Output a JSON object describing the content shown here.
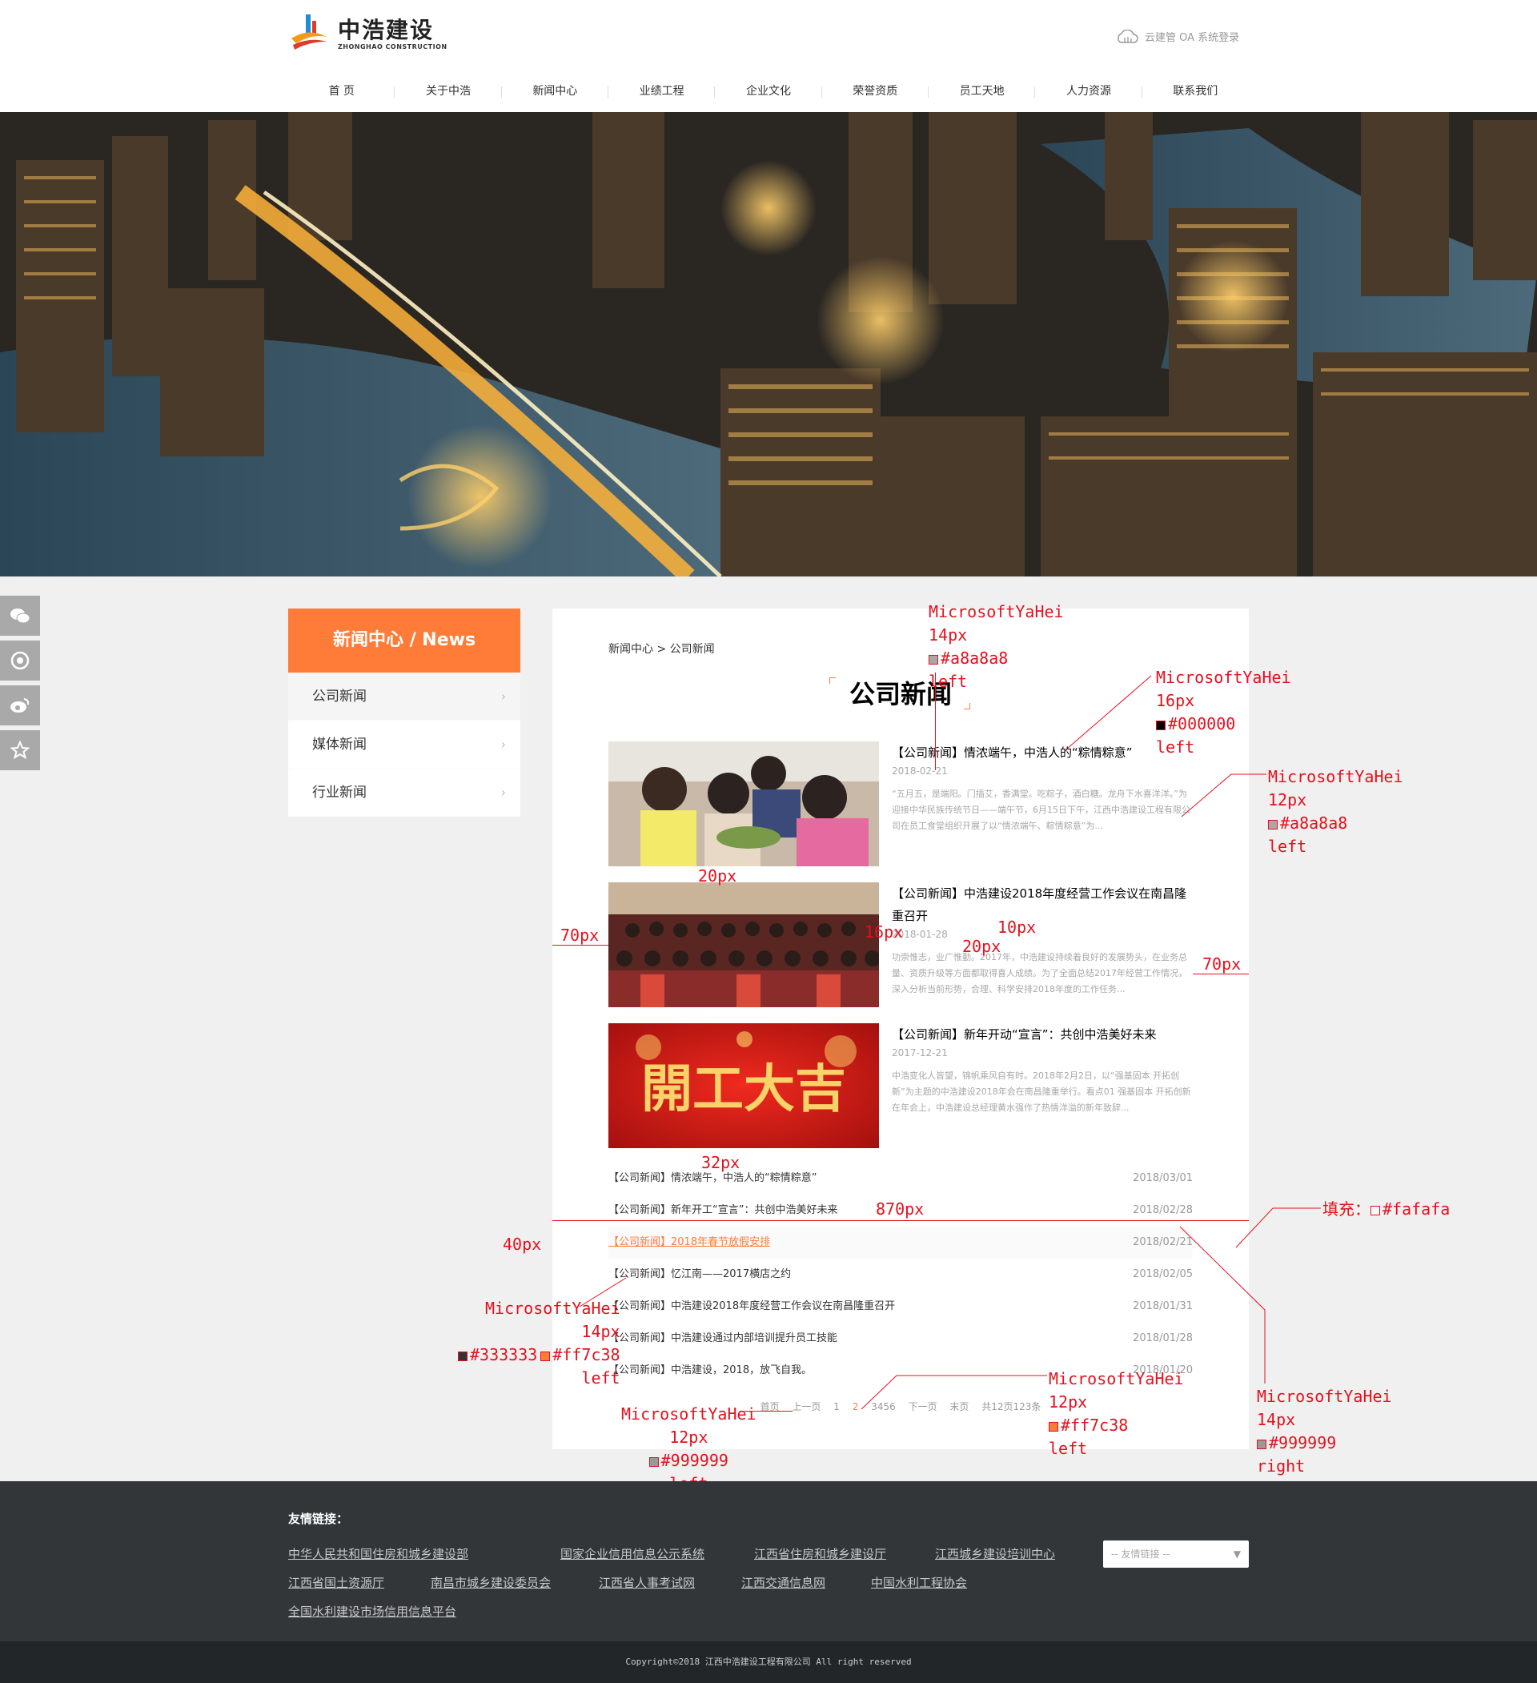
{
  "header": {
    "logo_cn": "中浩建设",
    "logo_en": "ZHONGHAO CONSTRUCTION",
    "oa_link": "云建管 OA 系统登录"
  },
  "nav": [
    "首 页",
    "关于中浩",
    "新闻中心",
    "业绩工程",
    "企业文化",
    "荣誉资质",
    "员工天地",
    "人力资源",
    "联系我们"
  ],
  "sidebar": {
    "title": "新闻中心 / News",
    "items": [
      "公司新闻",
      "媒体新闻",
      "行业新闻"
    ]
  },
  "main": {
    "breadcrumb": "新闻中心 > 公司新闻",
    "title": "公司新闻",
    "featured": [
      {
        "title": "【公司新闻】情浓端午，中浩人的“粽情粽意”",
        "date": "2018-02-21",
        "desc": "“五月五，是端阳。门插艾，香满堂。吃粽子，酒白糖。龙舟下水喜洋洋。”为迎接中华民族传统节日——端午节，6月15日下午，江西中浩建设工程有限公司在员工食堂组织开展了以“情浓端午、粽情粽意”为..."
      },
      {
        "title": "【公司新闻】中浩建设2018年度经营工作会议在南昌隆重召开",
        "date": "2018-01-28",
        "desc": "功崇惟志，业广惟勤。2017年，中浩建设持续着良好的发展势头，在业务总量、资质升级等方面都取得喜人成绩。为了全面总结2017年经营工作情况，深入分析当前形势，合理、科学安排2018年度的工作任务..."
      },
      {
        "title": "【公司新闻】新年开动“宣言”：共创中浩美好未来",
        "date": "2017-12-21",
        "desc": "中浩变化人皆望，锦帆乘风自有时。2018年2月2日，以“强基固本 开拓创新”为主题的中浩建设2018年会在南昌隆重举行。看点01 强基固本 开拓创新 在年会上，中浩建设总经理黄水强作了热情洋溢的新年致辞..."
      }
    ],
    "banner_text": "開工大吉",
    "list": [
      {
        "title": "【公司新闻】情浓端午，中浩人的“粽情粽意”",
        "date": "2018/03/01"
      },
      {
        "title": "【公司新闻】新年开工“宣言”：共创中浩美好未来",
        "date": "2018/02/28"
      },
      {
        "title": "【公司新闻】2018年春节放假安排",
        "date": "2018/02/21"
      },
      {
        "title": "【公司新闻】忆江南——2017横店之约",
        "date": "2018/02/05"
      },
      {
        "title": "【公司新闻】中浩建设2018年度经营工作会议在南昌隆重召开",
        "date": "2018/01/31"
      },
      {
        "title": "【公司新闻】中浩建设通过内部培训提升员工技能",
        "date": "2018/01/28"
      },
      {
        "title": "【公司新闻】中浩建设，2018，放飞自我。",
        "date": "2018/01/20"
      }
    ],
    "pager": {
      "first": "首页",
      "prev": "上一页",
      "p1": "1",
      "p2": "2",
      "rest": "3456",
      "next": "下一页",
      "last": "末页",
      "total": "共12页123条"
    }
  },
  "annotations": {
    "a1": [
      "MicrosoftYaHei",
      "14px",
      "#a8a8a8",
      "left"
    ],
    "a2": [
      "MicrosoftYaHei",
      "16px",
      "#000000",
      "left"
    ],
    "a3": [
      "MicrosoftYaHei",
      "12px",
      "#a8a8a8",
      "left"
    ],
    "a4": [
      "MicrosoftYaHei",
      "14px",
      "#333333",
      "#ff7c38",
      "left"
    ],
    "a5": [
      "MicrosoftYaHei",
      "12px",
      "#999999",
      "left"
    ],
    "a6": [
      "MicrosoftYaHei",
      "12px",
      "#ff7c38",
      "left"
    ],
    "a7": [
      "MicrosoftYaHei",
      "14px",
      "#999999",
      "right"
    ],
    "dims": {
      "d20a": "20px",
      "d70a": "70px",
      "d16": "16px",
      "d10": "10px",
      "d20b": "20px",
      "d70b": "70px",
      "d32": "32px",
      "d870": "870px",
      "d40": "40px"
    },
    "fill": "填充：",
    "fill_color": "#fafafa"
  },
  "footer": {
    "label": "友情链接：",
    "links": [
      "中华人民共和国住房和城乡建设部",
      "国家企业信用信息公示系统",
      "江西省住房和城乡建设厅",
      "江西城乡建设培训中心",
      "江西省国土资源厅",
      "南昌市城乡建设委员会",
      "江西省人事考试网",
      "江西交通信息网",
      "中国水利工程协会",
      "全国水利建设市场信用信息平台"
    ],
    "select": "-- 友情链接 --",
    "copyright": "Copyright©2018 江西中浩建设工程有限公司 All right reserved"
  },
  "colors": {
    "accent": "#ff7c38",
    "annotation": "#e5101d",
    "footer_bg": "#333639"
  },
  "icons": [
    "wechat-icon",
    "shutter-icon",
    "weibo-icon",
    "star-icon",
    "cloud-icon",
    "chevron-right-icon",
    "chevron-down-icon"
  ]
}
